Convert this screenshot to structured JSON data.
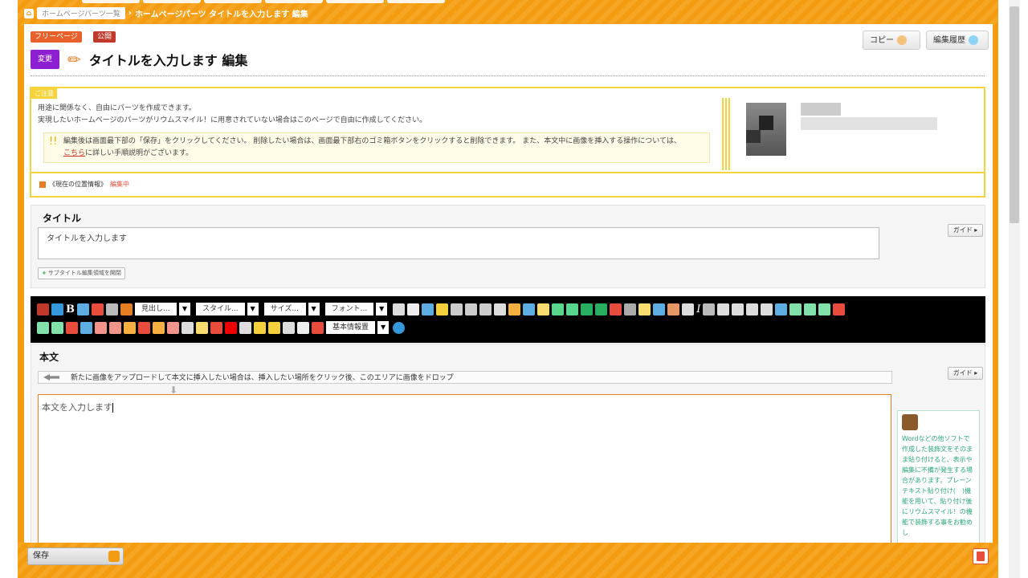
{
  "breadcrumb": {
    "home_icon": "home-icon",
    "items": [
      "ホームページパーツ一覧",
      "ホームページパーツ タイトルを入力します 編集"
    ]
  },
  "badges": {
    "type": "フリーページ",
    "status": "公開"
  },
  "header": {
    "edit_badge": "変更",
    "title": "タイトルを入力します 編集",
    "copy_label": "コピー",
    "history_label": "編集履歴"
  },
  "info": {
    "tag": "ご注意",
    "line1": "用途に関係なく、自由にパーツを作成できます。",
    "line2": "実現したいホームページのパーツがリウムスマイル！に用意されていない場合はこのページで自由に作成してください。",
    "notice1": "編集後は画面最下部の「保存」をクリックしてください。 削除したい場合は、画面最下部右のゴミ箱ボタンをクリックすると削除できます。 また、本文中に画像を挿入する操作については、",
    "notice_link": "こちら",
    "notice2": "に詳しい手順説明がございます。",
    "location_label": "《現在の位置情報》",
    "location_status": "編集中"
  },
  "title_section": {
    "label": "タイトル",
    "value": "タイトルを入力します",
    "guide": "ガイド",
    "subtitle_button": "サブタイトル編集領域を開閉"
  },
  "toolbar": {
    "format": "見出し...",
    "style": "スタイル...",
    "size": "サイズ...",
    "font": "フォント...",
    "info_select": "基本情報置"
  },
  "body_section": {
    "label": "本文",
    "upload_hint": "新たに画像をアップロードして本文に挿入したい場合は、挿入したい場所をクリック後、このエリアに画像をドロップ",
    "guide": "ガイド",
    "value": "本文を入力します"
  },
  "tip": {
    "text": "Wordなどの他ソフトで作成した装飾文をそのまま貼り付けると、表示や編集に不備が発生する場合があります。プレーンテキスト貼り付け(　)機能を用いて、貼り付け後にリウムスマイル！の機能で装飾する事をお勧めし"
  },
  "footer": {
    "save_label": "保存"
  },
  "colors": {
    "accent": "#f39c12",
    "edit_badge": "#8e1fd1",
    "notice": "#f5d33b"
  }
}
